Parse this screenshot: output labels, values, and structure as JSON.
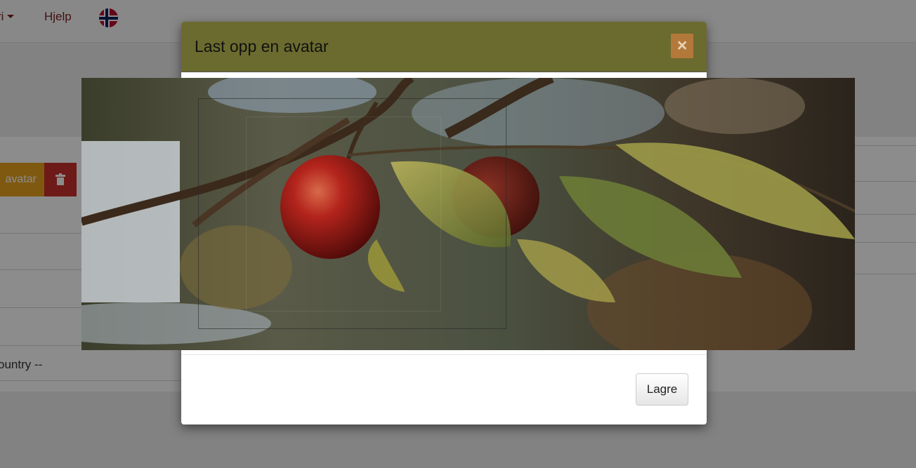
{
  "nav": {
    "cut_item_label": "ri",
    "help_label": "Hjelp",
    "language_flag": "flag-norway-icon"
  },
  "profile": {
    "avatar_button_label": "avatar",
    "delete_icon": "trash-icon",
    "country_placeholder": "ountry --"
  },
  "modal": {
    "title": "Last opp en avatar",
    "close_label": "×",
    "save_label": "Lagre",
    "image_description": "photo-apple-on-branch"
  },
  "colors": {
    "header_bg": "#6b6b2f",
    "close_bg": "#b3793a",
    "avatar_button": "#e8a21d",
    "delete_button": "#c9302c",
    "nav_link": "#7a2020"
  }
}
